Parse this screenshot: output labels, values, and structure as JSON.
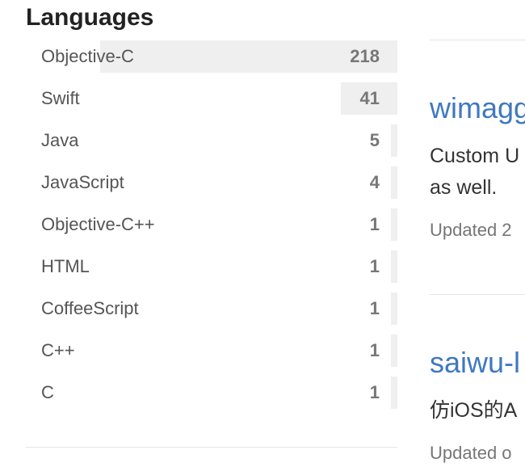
{
  "languages": {
    "title": "Languages",
    "items": [
      {
        "name": "Objective-C",
        "count": "218",
        "share": 1.0
      },
      {
        "name": "Swift",
        "count": "41",
        "share": 0.19
      },
      {
        "name": "Java",
        "count": "5",
        "share": 0.02
      },
      {
        "name": "JavaScript",
        "count": "4",
        "share": 0.02
      },
      {
        "name": "Objective-C++",
        "count": "1",
        "share": 0.01
      },
      {
        "name": "HTML",
        "count": "1",
        "share": 0.01
      },
      {
        "name": "CoffeeScript",
        "count": "1",
        "share": 0.01
      },
      {
        "name": "C++",
        "count": "1",
        "share": 0.01
      },
      {
        "name": "C",
        "count": "1",
        "share": 0.01
      }
    ]
  },
  "repos": [
    {
      "name": "wimagg",
      "description_lines": [
        "Custom U",
        "as well."
      ],
      "updated": "Updated 2"
    },
    {
      "name": "saiwu-l",
      "description_lines": [
        "仿iOS的A"
      ],
      "updated": "Updated o"
    }
  ],
  "colors": {
    "link": "#4078c0",
    "bar": "#efefef"
  }
}
